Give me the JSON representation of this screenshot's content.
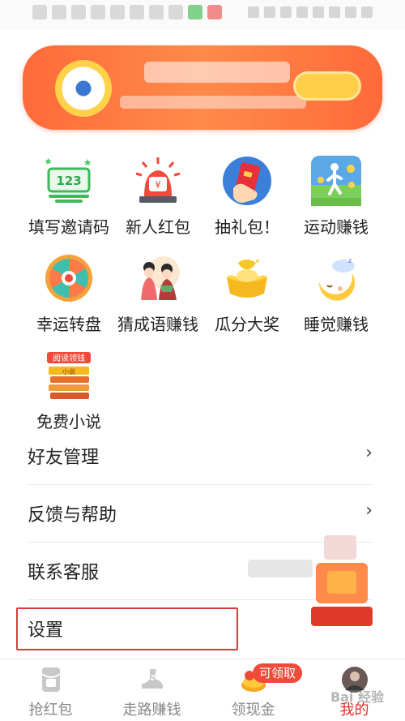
{
  "grid": {
    "items": [
      {
        "label": "填写邀请码",
        "icon": "invite-code-icon"
      },
      {
        "label": "新人红包",
        "icon": "red-envelope-alarm-icon"
      },
      {
        "label": "抽礼包！",
        "icon": "gift-pack-icon"
      },
      {
        "label": "运动赚钱",
        "icon": "walking-coins-icon"
      },
      {
        "label": "幸运转盘",
        "icon": "lucky-wheel-icon"
      },
      {
        "label": "猜成语赚钱",
        "icon": "idiom-guess-icon"
      },
      {
        "label": "瓜分大奖",
        "icon": "gold-ingot-icon"
      },
      {
        "label": "睡觉赚钱",
        "icon": "moon-sleep-icon"
      },
      {
        "label": "免费小说",
        "icon": "books-icon",
        "tag": "阅读领钱",
        "book_text": "小说"
      }
    ],
    "invite_icon_text": "123"
  },
  "list": {
    "items": [
      {
        "label": "好友管理",
        "chevron": "›"
      },
      {
        "label": "反馈与帮助",
        "chevron": "›"
      },
      {
        "label": "联系客服",
        "chevron": ""
      },
      {
        "label": "设置",
        "chevron": ""
      }
    ]
  },
  "nav": {
    "items": [
      {
        "label": "抢红包",
        "icon": "red-envelope-icon",
        "active": false
      },
      {
        "label": "走路赚钱",
        "icon": "shoe-icon",
        "active": false
      },
      {
        "label": "领现金",
        "icon": "coins-icon",
        "active": false
      },
      {
        "label": "我的",
        "icon": "avatar",
        "active": true
      }
    ],
    "badge": "可领取"
  },
  "watermark": "Bai 经验",
  "colors": {
    "accent": "#e0302e",
    "banner": "#ff7a44",
    "highlight_border": "#d93a3a"
  }
}
